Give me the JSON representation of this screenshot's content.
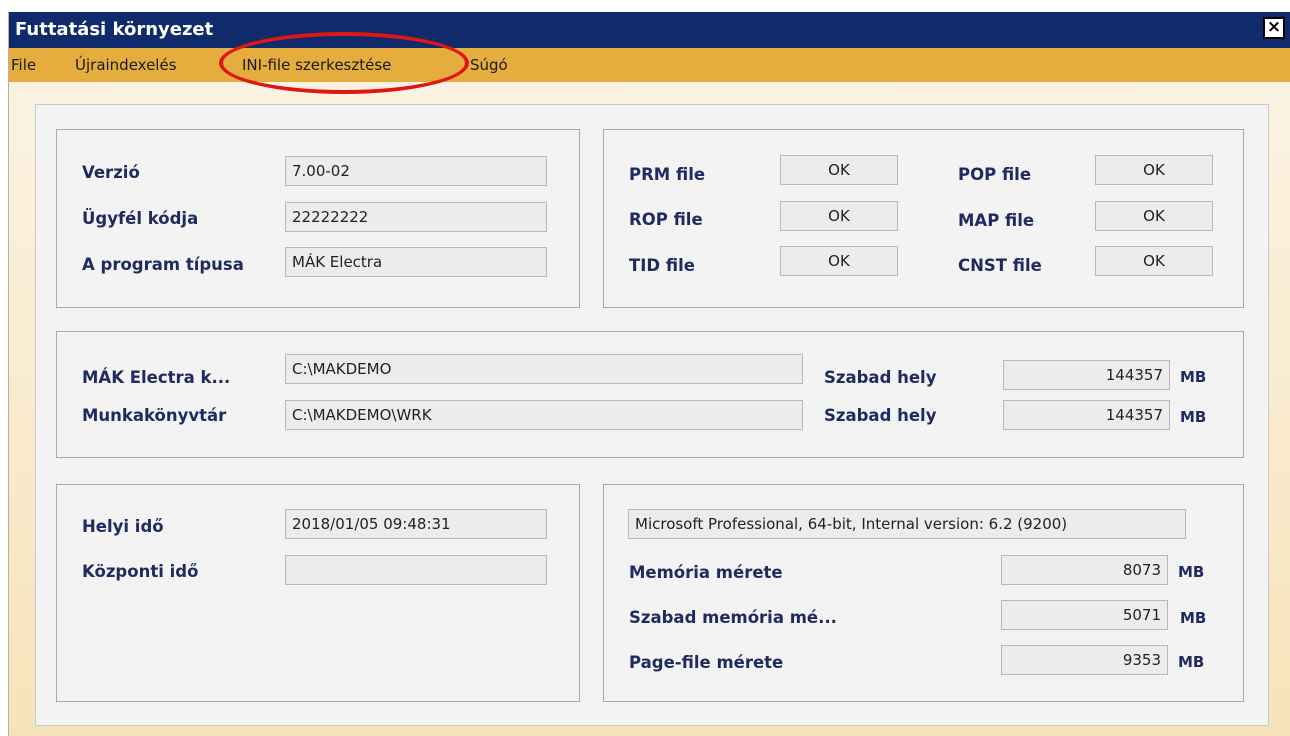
{
  "window": {
    "title": "Futtatási környezet",
    "close_label": "×"
  },
  "menu": {
    "items": [
      "File",
      "Újraindexelés",
      "INI-file szerkesztése",
      "Súgó"
    ]
  },
  "version_group": {
    "version_label": "Verzió",
    "version_value": "7.00-02",
    "client_label": "Ügyfél kódja",
    "client_value": "22222222",
    "type_label": "A program típusa",
    "type_value": "MÁK Electra"
  },
  "files_group": {
    "prm_label": "PRM file",
    "prm_value": "OK",
    "rop_label": "ROP file",
    "rop_value": "OK",
    "tid_label": "TID file",
    "tid_value": "OK",
    "pop_label": "POP file",
    "pop_value": "OK",
    "map_label": "MAP file",
    "map_value": "OK",
    "cnst_label": "CNST file",
    "cnst_value": "OK"
  },
  "paths_group": {
    "electra_label": "MÁK Electra k...",
    "electra_value": "C:\\MAKDEMO",
    "work_label": "Munkakönyvtár",
    "work_value": "C:\\MAKDEMO\\WRK",
    "free1_label": "Szabad hely",
    "free1_value": "144357",
    "free1_unit": "MB",
    "free2_label": "Szabad hely",
    "free2_value": "144357",
    "free2_unit": "MB"
  },
  "time_group": {
    "local_label": "Helyi idő",
    "local_value": "2018/01/05 09:48:31",
    "central_label": "Központi idő",
    "central_value": ""
  },
  "system_group": {
    "os_value": "Microsoft Professional, 64-bit, Internal version: 6.2 (9200)",
    "mem_label": "Memória mérete",
    "mem_value": "8073",
    "mem_unit": "MB",
    "freemem_label": "Szabad memória mé...",
    "freemem_value": "5071",
    "freemem_unit": "MB",
    "page_label": "Page-file mérete",
    "page_value": "9353",
    "page_unit": "MB"
  },
  "colors": {
    "titlebar": "#102b6b",
    "menubar": "#e5ad3d",
    "highlight": "#e01616",
    "label": "#1f2a5e"
  }
}
